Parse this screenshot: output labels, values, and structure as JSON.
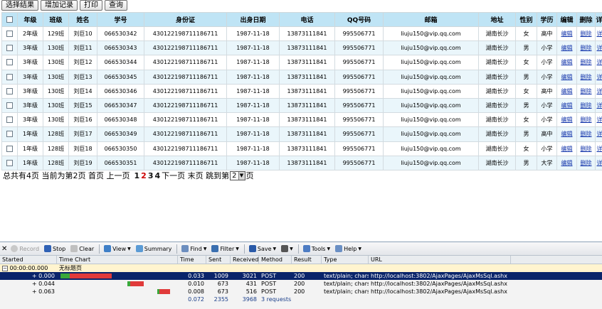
{
  "toolbar": {
    "buttons": [
      "选择结果",
      "增加记录",
      "打印",
      "查询"
    ]
  },
  "table": {
    "columns": [
      "年级",
      "班级",
      "姓名",
      "学号",
      "身份证",
      "出身日期",
      "电话",
      "QQ号码",
      "邮箱",
      "地址",
      "性别",
      "学历",
      "编辑",
      "删除",
      "详细"
    ],
    "rows": [
      [
        "2年级",
        "129班",
        "刘巨10",
        "066530342",
        "430122198711186711",
        "1987-11-18",
        "13873111841",
        "995506771",
        "liuju150@vip.qq.com",
        "湖南长沙",
        "女",
        "高中",
        "编辑",
        "删除",
        "详细"
      ],
      [
        "3年级",
        "130班",
        "刘巨11",
        "066530343",
        "430122198711186711",
        "1987-11-18",
        "13873111841",
        "995506771",
        "liuju150@vip.qq.com",
        "湖南长沙",
        "男",
        "小学",
        "编辑",
        "删除",
        "详细"
      ],
      [
        "3年级",
        "130班",
        "刘巨12",
        "066530344",
        "430122198711186711",
        "1987-11-18",
        "13873111841",
        "995506771",
        "liuju150@vip.qq.com",
        "湖南长沙",
        "女",
        "小学",
        "编辑",
        "删除",
        "详细"
      ],
      [
        "3年级",
        "130班",
        "刘巨13",
        "066530345",
        "430122198711186711",
        "1987-11-18",
        "13873111841",
        "995506771",
        "liuju150@vip.qq.com",
        "湖南长沙",
        "男",
        "小学",
        "编辑",
        "删除",
        "详细"
      ],
      [
        "3年级",
        "130班",
        "刘巨14",
        "066530346",
        "430122198711186711",
        "1987-11-18",
        "13873111841",
        "995506771",
        "liuju150@vip.qq.com",
        "湖南长沙",
        "女",
        "高中",
        "编辑",
        "删除",
        "详细"
      ],
      [
        "3年级",
        "130班",
        "刘巨15",
        "066530347",
        "430122198711186711",
        "1987-11-18",
        "13873111841",
        "995506771",
        "liuju150@vip.qq.com",
        "湖南长沙",
        "男",
        "小学",
        "编辑",
        "删除",
        "详细"
      ],
      [
        "3年级",
        "130班",
        "刘巨16",
        "066530348",
        "430122198711186711",
        "1987-11-18",
        "13873111841",
        "995506771",
        "liuju150@vip.qq.com",
        "湖南长沙",
        "女",
        "小学",
        "编辑",
        "删除",
        "详细"
      ],
      [
        "1年级",
        "128班",
        "刘巨17",
        "066530349",
        "430122198711186711",
        "1987-11-18",
        "13873111841",
        "995506771",
        "liuju150@vip.qq.com",
        "湖南长沙",
        "男",
        "高中",
        "编辑",
        "删除",
        "详细"
      ],
      [
        "1年级",
        "128班",
        "刘巨18",
        "066530350",
        "430122198711186711",
        "1987-11-18",
        "13873111841",
        "995506771",
        "liuju150@vip.qq.com",
        "湖南长沙",
        "女",
        "小学",
        "编辑",
        "删除",
        "详细"
      ],
      [
        "1年级",
        "128班",
        "刘巨19",
        "066530351",
        "430122198711186711",
        "1987-11-18",
        "13873111841",
        "995506771",
        "liuju150@vip.qq.com",
        "湖南长沙",
        "男",
        "大学",
        "编辑",
        "删除",
        "详细"
      ]
    ]
  },
  "pager": {
    "summary": "总共有4页 当前为第2页 首页 上一页",
    "pages": [
      "1",
      "2",
      "3",
      "4"
    ],
    "current_page": "2",
    "after": "下一页 末页 跳到第",
    "select_value": "2",
    "suffix": "页"
  },
  "debugger": {
    "toolbar": [
      {
        "label": "Record",
        "icon": "record-icon",
        "disabled": true,
        "caret": false
      },
      {
        "label": "Stop",
        "icon": "stop-icon",
        "disabled": false,
        "caret": false
      },
      {
        "label": "Clear",
        "icon": "clear-icon",
        "disabled": false,
        "caret": false
      },
      {
        "label": "View",
        "icon": "view-icon",
        "disabled": false,
        "caret": true
      },
      {
        "label": "Summary",
        "icon": "summary-icon",
        "disabled": false,
        "caret": false
      },
      {
        "label": "Find",
        "icon": "find-icon",
        "disabled": false,
        "caret": true
      },
      {
        "label": "Filter",
        "icon": "filter-icon",
        "disabled": false,
        "caret": true
      },
      {
        "label": "Save",
        "icon": "save-icon",
        "disabled": false,
        "caret": true
      },
      {
        "label": "",
        "icon": "print-icon",
        "disabled": false,
        "caret": true
      },
      {
        "label": "Tools",
        "icon": "tools-icon",
        "disabled": false,
        "caret": true
      },
      {
        "label": "Help",
        "icon": "help-icon",
        "disabled": false,
        "caret": true
      }
    ],
    "headers": [
      "Started",
      "Time Chart",
      "Time",
      "Sent",
      "Received",
      "Method",
      "Result",
      "Type",
      "URL"
    ],
    "group": {
      "started": "00:00:00.000",
      "title": "无标题页"
    },
    "requests": [
      {
        "started": "+ 0.000",
        "time": "0.033",
        "sent": "1009",
        "received": "3021",
        "method": "POST",
        "result": "200",
        "type": "text/plain; chars...",
        "url": "http://localhost:3802/AjaxPages/AjaxMsSql.ashx",
        "bar_start": 0.0,
        "bar_len": 0.45
      },
      {
        "started": "+ 0.044",
        "time": "0.010",
        "sent": "673",
        "received": "431",
        "method": "POST",
        "result": "200",
        "type": "text/plain; chars...",
        "url": "http://localhost:3802/AjaxPages/AjaxMsSql.ashx",
        "bar_start": 0.59,
        "bar_len": 0.14
      },
      {
        "started": "+ 0.063",
        "time": "0.008",
        "sent": "673",
        "received": "516",
        "method": "POST",
        "result": "200",
        "type": "text/plain; chars...",
        "url": "http://localhost:3802/AjaxPages/AjaxMsSql.ashx",
        "bar_start": 0.85,
        "bar_len": 0.11
      }
    ],
    "totals": {
      "time": "0.072",
      "sent": "2355",
      "received": "3968",
      "requests": "3 requests"
    }
  }
}
